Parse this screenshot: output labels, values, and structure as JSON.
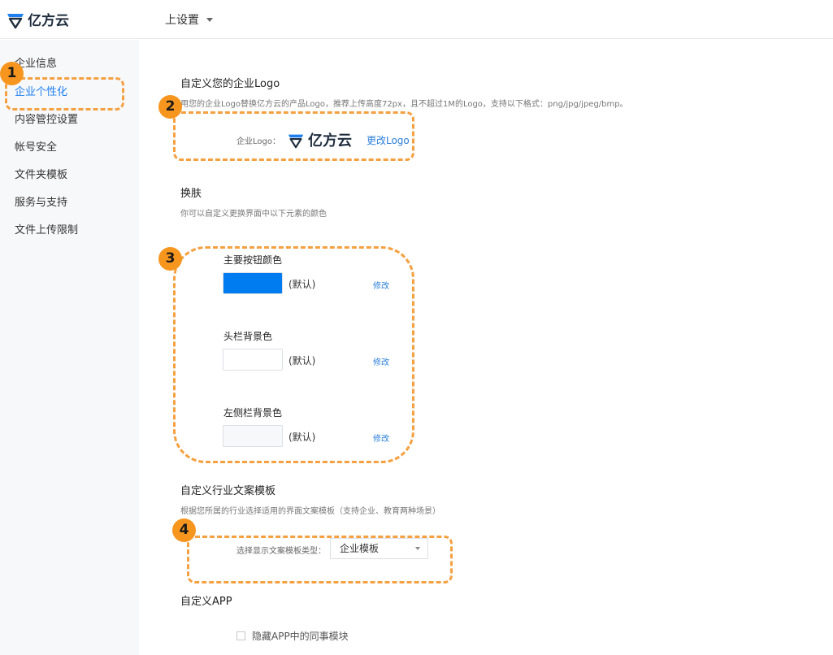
{
  "header": {
    "logo_text": "亿方云",
    "menu_label": "上设置"
  },
  "sidebar": {
    "items": [
      {
        "label": "企业信息"
      },
      {
        "label": "企业个性化"
      },
      {
        "label": "内容管控设置"
      },
      {
        "label": "帐号安全"
      },
      {
        "label": "文件夹模板"
      },
      {
        "label": "服务与支持"
      },
      {
        "label": "文件上传限制"
      }
    ]
  },
  "logo_section": {
    "title": "自定义您的企业Logo",
    "desc": "用您的企业Logo替换亿方云的产品Logo，推荐上传高度72px，且不超过1M的Logo，支持以下格式：png/jpg/jpeg/bmp。",
    "logo_label": "企业Logo：",
    "logo_text": "亿方云",
    "change_label": "更改Logo"
  },
  "skin_section": {
    "title": "换肤",
    "desc": "你可以自定义更换界面中以下元素的颜色",
    "items": [
      {
        "title": "主要按钮颜色",
        "color": "#007cf0",
        "default_label": "(默认)",
        "modify_label": "修改"
      },
      {
        "title": "头栏背景色",
        "color": "#ffffff",
        "default_label": "(默认)",
        "modify_label": "修改"
      },
      {
        "title": "左侧栏背景色",
        "color": "#f7f8fa",
        "default_label": "(默认)",
        "modify_label": "修改"
      }
    ]
  },
  "template_section": {
    "title": "自定义行业文案模板",
    "desc": "根据您所属的行业选择适用的界面文案模板（支持企业、教育两种场景）",
    "select_label": "选择显示文案模板类型：",
    "select_value": "企业模板"
  },
  "app_section": {
    "title": "自定义APP",
    "checkbox_label": "隐藏APP中的同事模块",
    "checked": false
  },
  "annotations": {
    "badges": [
      "1",
      "2",
      "3",
      "4"
    ],
    "color": "#f7961e"
  },
  "colors": {
    "accent": "#1d7ff0",
    "link": "#2b7fd8",
    "sidebar_bg": "#f7f8fa",
    "annotation_dash": "#f5a041"
  }
}
